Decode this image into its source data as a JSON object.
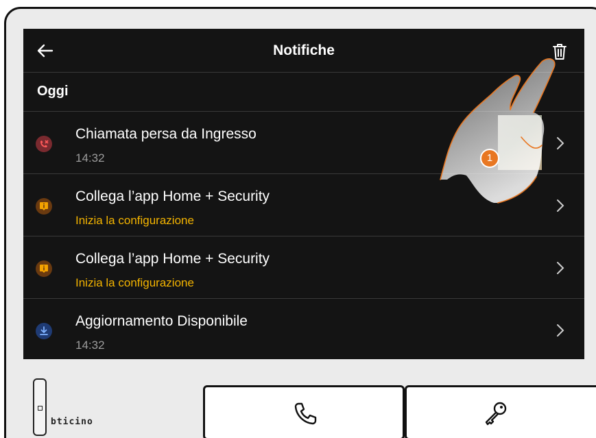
{
  "header": {
    "title": "Notifiche",
    "back_icon": "arrow-left-icon",
    "trash_icon": "trash-icon"
  },
  "section": {
    "label": "Oggi"
  },
  "notifications": [
    {
      "title": "Chiamata persa da Ingresso",
      "subtitle": "14:32",
      "icon": "missed-call-icon",
      "icon_color": "#e05555",
      "subtitle_style": "muted"
    },
    {
      "title": "Collega l’app Home + Security",
      "subtitle": "Inizia la configurazione",
      "icon": "info-alert-icon",
      "icon_color": "#f4a300",
      "subtitle_style": "warning"
    },
    {
      "title": "Collega l’app Home + Security",
      "subtitle": "Inizia la configurazione",
      "icon": "info-alert-icon",
      "icon_color": "#f4a300",
      "subtitle_style": "warning"
    },
    {
      "title": "Aggiornamento Disponibile",
      "subtitle": "14:32",
      "icon": "download-icon",
      "icon_color": "#4a8cff",
      "subtitle_style": "muted"
    }
  ],
  "overlay": {
    "step_number": "1"
  },
  "device": {
    "brand": "bticino",
    "call_button_icon": "phone-icon",
    "key_button_icon": "key-icon"
  },
  "colors": {
    "screen_bg": "#141414",
    "accent_warning": "#f4b400",
    "step_badge": "#e87722"
  }
}
